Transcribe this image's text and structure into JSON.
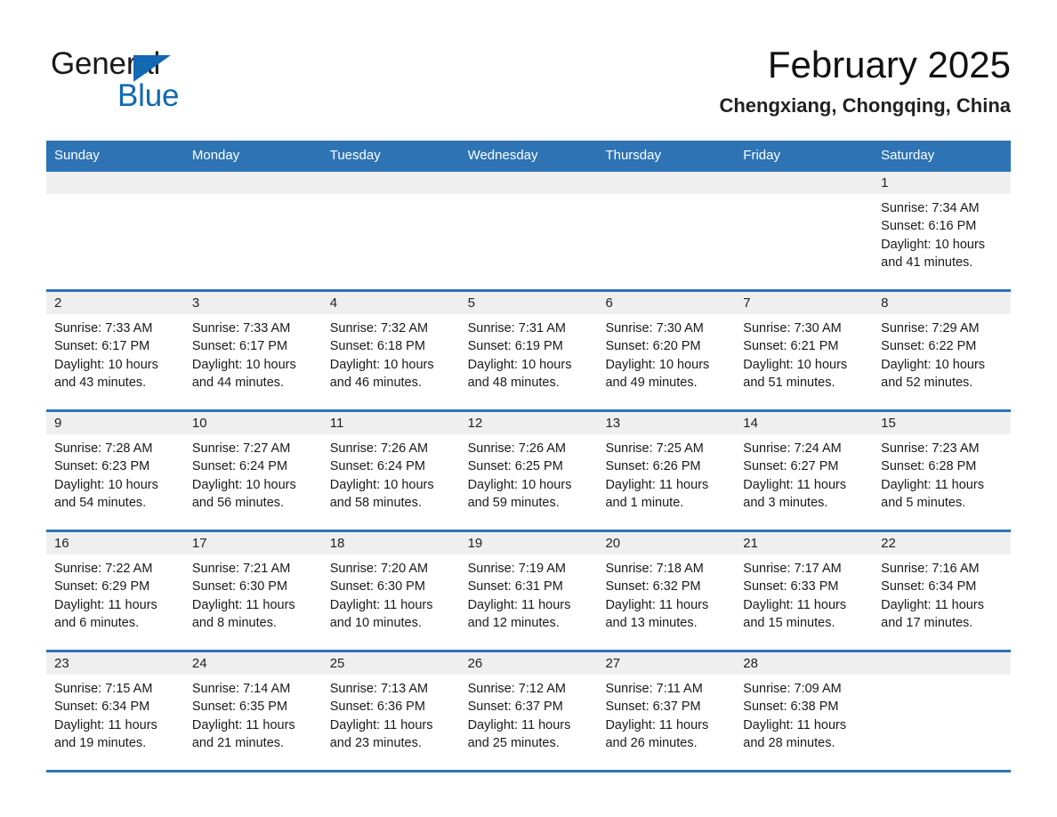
{
  "brand": {
    "name_part1": "General",
    "name_part2": "Blue",
    "logo_icon": "triangle-logo-icon",
    "accent_color": "#1268b3"
  },
  "header": {
    "title": "February 2025",
    "subtitle": "Chengxiang, Chongqing, China"
  },
  "theme": {
    "header_blue": "#2e74b5",
    "day_band_gray": "#efefef"
  },
  "weekdays": [
    "Sunday",
    "Monday",
    "Tuesday",
    "Wednesday",
    "Thursday",
    "Friday",
    "Saturday"
  ],
  "weeks": [
    [
      {
        "day": "",
        "sunrise": "",
        "sunset": "",
        "daylight": "",
        "empty": true
      },
      {
        "day": "",
        "sunrise": "",
        "sunset": "",
        "daylight": "",
        "empty": true
      },
      {
        "day": "",
        "sunrise": "",
        "sunset": "",
        "daylight": "",
        "empty": true
      },
      {
        "day": "",
        "sunrise": "",
        "sunset": "",
        "daylight": "",
        "empty": true
      },
      {
        "day": "",
        "sunrise": "",
        "sunset": "",
        "daylight": "",
        "empty": true
      },
      {
        "day": "",
        "sunrise": "",
        "sunset": "",
        "daylight": "",
        "empty": true
      },
      {
        "day": "1",
        "sunrise": "Sunrise: 7:34 AM",
        "sunset": "Sunset: 6:16 PM",
        "daylight": "Daylight: 10 hours and 41 minutes."
      }
    ],
    [
      {
        "day": "2",
        "sunrise": "Sunrise: 7:33 AM",
        "sunset": "Sunset: 6:17 PM",
        "daylight": "Daylight: 10 hours and 43 minutes."
      },
      {
        "day": "3",
        "sunrise": "Sunrise: 7:33 AM",
        "sunset": "Sunset: 6:17 PM",
        "daylight": "Daylight: 10 hours and 44 minutes."
      },
      {
        "day": "4",
        "sunrise": "Sunrise: 7:32 AM",
        "sunset": "Sunset: 6:18 PM",
        "daylight": "Daylight: 10 hours and 46 minutes."
      },
      {
        "day": "5",
        "sunrise": "Sunrise: 7:31 AM",
        "sunset": "Sunset: 6:19 PM",
        "daylight": "Daylight: 10 hours and 48 minutes."
      },
      {
        "day": "6",
        "sunrise": "Sunrise: 7:30 AM",
        "sunset": "Sunset: 6:20 PM",
        "daylight": "Daylight: 10 hours and 49 minutes."
      },
      {
        "day": "7",
        "sunrise": "Sunrise: 7:30 AM",
        "sunset": "Sunset: 6:21 PM",
        "daylight": "Daylight: 10 hours and 51 minutes."
      },
      {
        "day": "8",
        "sunrise": "Sunrise: 7:29 AM",
        "sunset": "Sunset: 6:22 PM",
        "daylight": "Daylight: 10 hours and 52 minutes."
      }
    ],
    [
      {
        "day": "9",
        "sunrise": "Sunrise: 7:28 AM",
        "sunset": "Sunset: 6:23 PM",
        "daylight": "Daylight: 10 hours and 54 minutes."
      },
      {
        "day": "10",
        "sunrise": "Sunrise: 7:27 AM",
        "sunset": "Sunset: 6:24 PM",
        "daylight": "Daylight: 10 hours and 56 minutes."
      },
      {
        "day": "11",
        "sunrise": "Sunrise: 7:26 AM",
        "sunset": "Sunset: 6:24 PM",
        "daylight": "Daylight: 10 hours and 58 minutes."
      },
      {
        "day": "12",
        "sunrise": "Sunrise: 7:26 AM",
        "sunset": "Sunset: 6:25 PM",
        "daylight": "Daylight: 10 hours and 59 minutes."
      },
      {
        "day": "13",
        "sunrise": "Sunrise: 7:25 AM",
        "sunset": "Sunset: 6:26 PM",
        "daylight": "Daylight: 11 hours and 1 minute."
      },
      {
        "day": "14",
        "sunrise": "Sunrise: 7:24 AM",
        "sunset": "Sunset: 6:27 PM",
        "daylight": "Daylight: 11 hours and 3 minutes."
      },
      {
        "day": "15",
        "sunrise": "Sunrise: 7:23 AM",
        "sunset": "Sunset: 6:28 PM",
        "daylight": "Daylight: 11 hours and 5 minutes."
      }
    ],
    [
      {
        "day": "16",
        "sunrise": "Sunrise: 7:22 AM",
        "sunset": "Sunset: 6:29 PM",
        "daylight": "Daylight: 11 hours and 6 minutes."
      },
      {
        "day": "17",
        "sunrise": "Sunrise: 7:21 AM",
        "sunset": "Sunset: 6:30 PM",
        "daylight": "Daylight: 11 hours and 8 minutes."
      },
      {
        "day": "18",
        "sunrise": "Sunrise: 7:20 AM",
        "sunset": "Sunset: 6:30 PM",
        "daylight": "Daylight: 11 hours and 10 minutes."
      },
      {
        "day": "19",
        "sunrise": "Sunrise: 7:19 AM",
        "sunset": "Sunset: 6:31 PM",
        "daylight": "Daylight: 11 hours and 12 minutes."
      },
      {
        "day": "20",
        "sunrise": "Sunrise: 7:18 AM",
        "sunset": "Sunset: 6:32 PM",
        "daylight": "Daylight: 11 hours and 13 minutes."
      },
      {
        "day": "21",
        "sunrise": "Sunrise: 7:17 AM",
        "sunset": "Sunset: 6:33 PM",
        "daylight": "Daylight: 11 hours and 15 minutes."
      },
      {
        "day": "22",
        "sunrise": "Sunrise: 7:16 AM",
        "sunset": "Sunset: 6:34 PM",
        "daylight": "Daylight: 11 hours and 17 minutes."
      }
    ],
    [
      {
        "day": "23",
        "sunrise": "Sunrise: 7:15 AM",
        "sunset": "Sunset: 6:34 PM",
        "daylight": "Daylight: 11 hours and 19 minutes."
      },
      {
        "day": "24",
        "sunrise": "Sunrise: 7:14 AM",
        "sunset": "Sunset: 6:35 PM",
        "daylight": "Daylight: 11 hours and 21 minutes."
      },
      {
        "day": "25",
        "sunrise": "Sunrise: 7:13 AM",
        "sunset": "Sunset: 6:36 PM",
        "daylight": "Daylight: 11 hours and 23 minutes."
      },
      {
        "day": "26",
        "sunrise": "Sunrise: 7:12 AM",
        "sunset": "Sunset: 6:37 PM",
        "daylight": "Daylight: 11 hours and 25 minutes."
      },
      {
        "day": "27",
        "sunrise": "Sunrise: 7:11 AM",
        "sunset": "Sunset: 6:37 PM",
        "daylight": "Daylight: 11 hours and 26 minutes."
      },
      {
        "day": "28",
        "sunrise": "Sunrise: 7:09 AM",
        "sunset": "Sunset: 6:38 PM",
        "daylight": "Daylight: 11 hours and 28 minutes."
      },
      {
        "day": "",
        "sunrise": "",
        "sunset": "",
        "daylight": "",
        "empty": true
      }
    ]
  ]
}
